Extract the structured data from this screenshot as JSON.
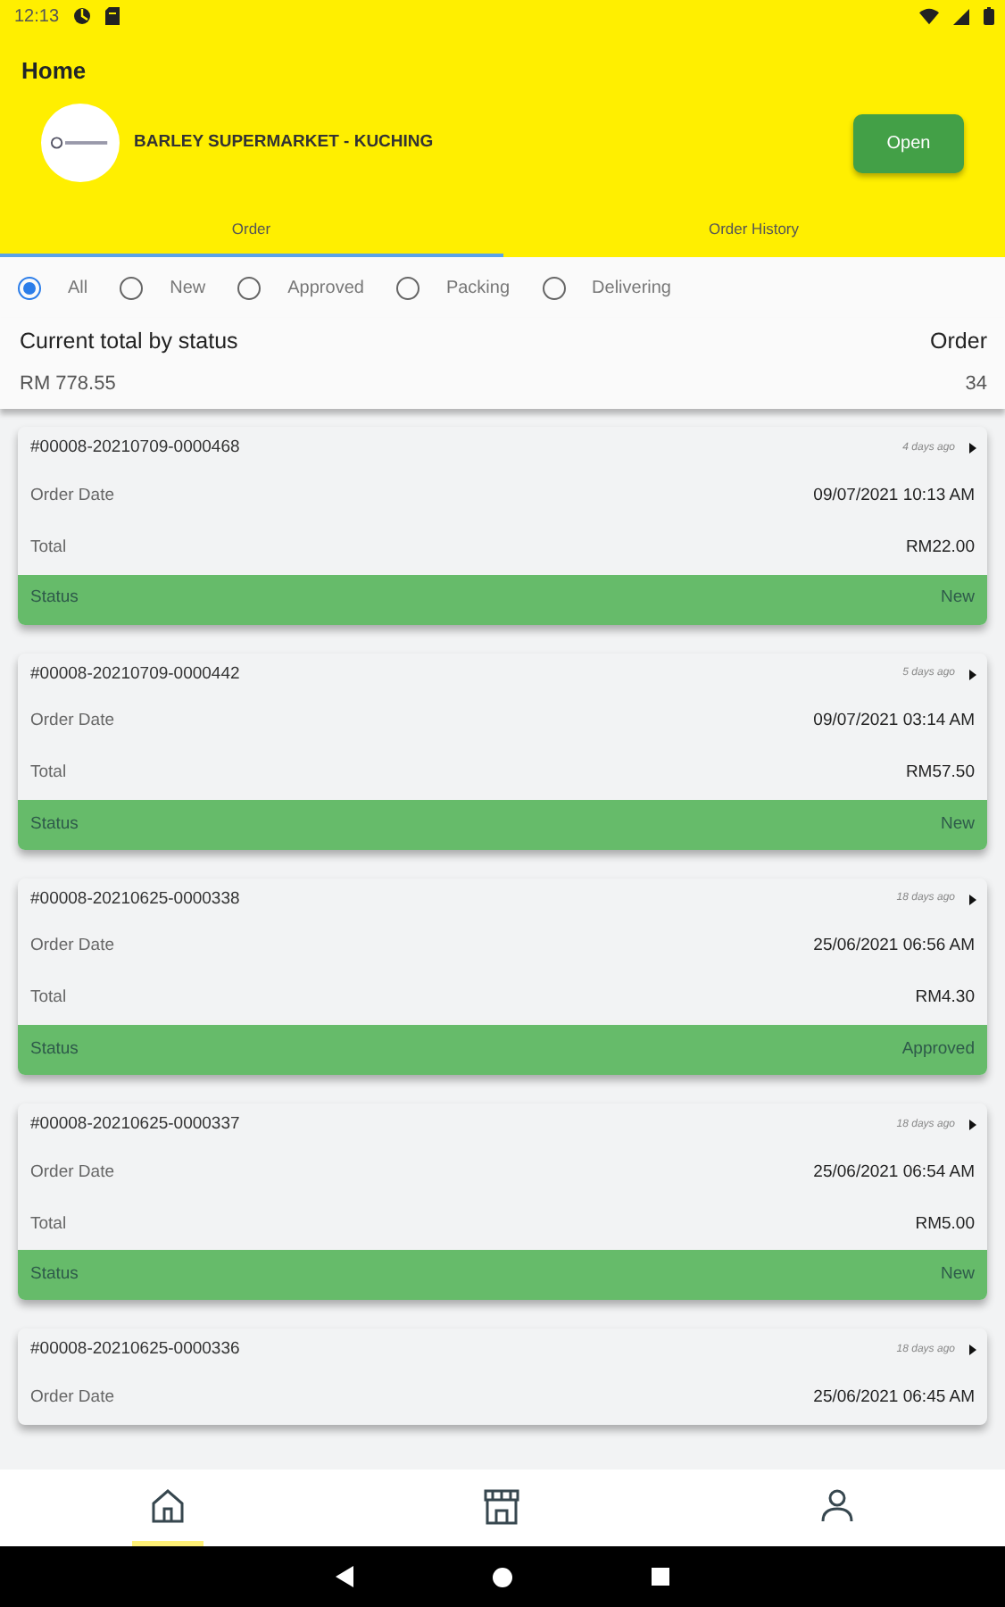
{
  "status_bar": {
    "time": "12:13"
  },
  "app_bar": {
    "title": "Home"
  },
  "store": {
    "name": "BARLEY SUPERMARKET - KUCHING",
    "button": "Open"
  },
  "tabs": [
    {
      "label": "Order",
      "selected": true
    },
    {
      "label": "Order History",
      "selected": false
    }
  ],
  "filters": [
    {
      "label": "All",
      "selected": true
    },
    {
      "label": "New",
      "selected": false
    },
    {
      "label": "Approved",
      "selected": false
    },
    {
      "label": "Packing",
      "selected": false
    },
    {
      "label": "Delivering",
      "selected": false
    }
  ],
  "summary": {
    "title": "Current total by status",
    "amount": "RM 778.55",
    "count_label": "Order",
    "count": "34"
  },
  "orders": [
    {
      "id": "#00008-20210709-0000468",
      "age": "4 days ago",
      "date_label": "Order Date",
      "date": "09/07/2021 10:13 AM",
      "total_label": "Total",
      "total": "RM22.00",
      "status_label": "Status",
      "status": "New"
    },
    {
      "id": "#00008-20210709-0000442",
      "age": "5 days ago",
      "date_label": "Order Date",
      "date": "09/07/2021 03:14 AM",
      "total_label": "Total",
      "total": "RM57.50",
      "status_label": "Status",
      "status": "New"
    },
    {
      "id": "#00008-20210625-0000338",
      "age": "18 days ago",
      "date_label": "Order Date",
      "date": "25/06/2021 06:56 AM",
      "total_label": "Total",
      "total": "RM4.30",
      "status_label": "Status",
      "status": "Approved"
    },
    {
      "id": "#00008-20210625-0000337",
      "age": "18 days ago",
      "date_label": "Order Date",
      "date": "25/06/2021 06:54 AM",
      "total_label": "Total",
      "total": "RM5.00",
      "status_label": "Status",
      "status": "New"
    },
    {
      "id": "#00008-20210625-0000336",
      "age": "18 days ago",
      "date_label": "Order Date",
      "date": "25/06/2021 06:45 AM"
    }
  ],
  "bottom_nav": [
    {
      "kind": "home",
      "selected": true
    },
    {
      "kind": "store",
      "selected": false
    },
    {
      "kind": "profile",
      "selected": false
    }
  ]
}
